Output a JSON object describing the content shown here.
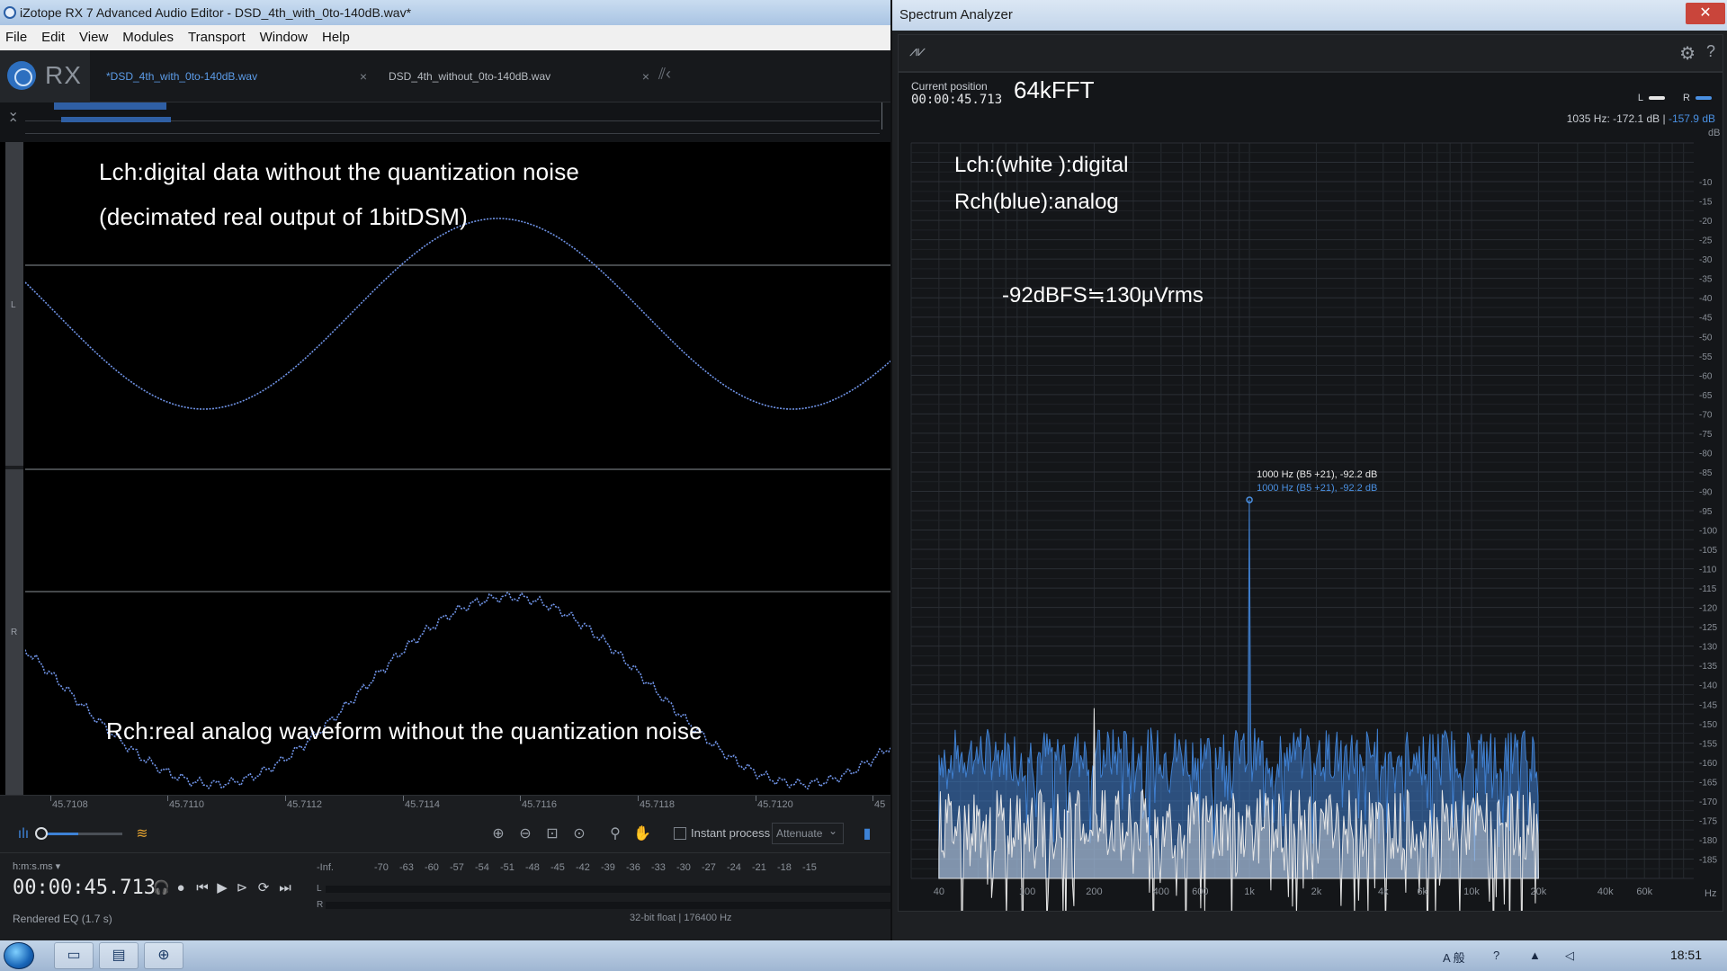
{
  "rx": {
    "title": "iZotope RX 7 Advanced Audio Editor - DSD_4th_with_0to-140dB.wav*",
    "menu": [
      "File",
      "Edit",
      "View",
      "Modules",
      "Transport",
      "Window",
      "Help"
    ],
    "logo": "RX",
    "tabs": [
      {
        "label": "*DSD_4th_with_0to-140dB.wav",
        "close": "×"
      },
      {
        "label": "DSD_4th_without_0to-140dB.wav",
        "close": "×"
      }
    ],
    "channel_l": "L",
    "channel_r": "R",
    "annotations": {
      "lch_line1": "Lch:digital data without the quantization noise",
      "lch_line2": "(decimated real output of 1bitDSM)",
      "rch": "Rch:real analog waveform without the quantization noise"
    },
    "time_ticks": [
      "45.7108",
      "45.7110",
      "45.7112",
      "45.7114",
      "45.7116",
      "45.7118",
      "45.7120",
      "45"
    ],
    "instant_process_label": "Instant process",
    "attenuate_value": "Attenuate",
    "time_format": "h:m:s.ms ▾",
    "current_time": "00:00:45.713",
    "status": "Rendered EQ (1.7 s)",
    "meter_labels": [
      "-Inf.",
      "-70",
      "-63",
      "-60",
      "-57",
      "-54",
      "-51",
      "-48",
      "-45",
      "-42",
      "-39",
      "-36",
      "-33",
      "-30",
      "-27",
      "-24",
      "-21",
      "-18",
      "-15"
    ],
    "meter_l": "L",
    "meter_r": "R",
    "format": "32-bit float | 176400 Hz",
    "zoom_level": 0.45
  },
  "analyzer": {
    "title": "Spectrum Analyzer",
    "close": "✕",
    "position_label": "Current position",
    "position_value": "00:00:45.713",
    "fft_label": "64kFFT",
    "legend_l": "L",
    "legend_r": "R",
    "readout_l": "1035 Hz: -172.1 dB",
    "readout_sep": " | ",
    "readout_r": "-157.9 dB",
    "db_unit": "dB",
    "hz_unit": "Hz",
    "annot_lch": "Lch:(white ):digital",
    "annot_rch": "Rch(blue):analog",
    "annot_level": "-92dBFS≒130μVrms",
    "peak_label_l": "1000 Hz (B5 +21), -92.2 dB",
    "peak_label_r": "1000 Hz (B5 +21), -92.2 dB"
  },
  "colors": {
    "waveform": "#6f93e6",
    "spectrum_r": "#3f7fcf",
    "spectrum_l": "#e6e6e6",
    "accent": "#4a90e2"
  },
  "chart_data": {
    "type": "area",
    "xscale": "log",
    "xlim": [
      30,
      100000
    ],
    "ylim": [
      -190,
      0
    ],
    "x_ticks": [
      {
        "v": 40,
        "label": "40"
      },
      {
        "v": 100,
        "label": "100"
      },
      {
        "v": 200,
        "label": "200"
      },
      {
        "v": 400,
        "label": "400"
      },
      {
        "v": 600,
        "label": "600"
      },
      {
        "v": 1000,
        "label": "1k"
      },
      {
        "v": 2000,
        "label": "2k"
      },
      {
        "v": 4000,
        "label": "4k"
      },
      {
        "v": 6000,
        "label": "6k"
      },
      {
        "v": 10000,
        "label": "10k"
      },
      {
        "v": 20000,
        "label": "20k"
      },
      {
        "v": 40000,
        "label": "40k"
      },
      {
        "v": 60000,
        "label": "60k"
      }
    ],
    "y_ticks": [
      -10,
      -15,
      -20,
      -25,
      -30,
      -35,
      -40,
      -45,
      -50,
      -55,
      -60,
      -65,
      -70,
      -75,
      -80,
      -85,
      -90,
      -95,
      -100,
      -105,
      -110,
      -115,
      -120,
      -125,
      -130,
      -135,
      -140,
      -145,
      -150,
      -155,
      -160,
      -165,
      -170,
      -175,
      -180,
      -185
    ],
    "series": [
      {
        "name": "R",
        "floor_db": -158,
        "upper_hz": 20000,
        "peak": {
          "hz": 1000,
          "db": -92.2
        }
      },
      {
        "name": "L",
        "floor_db": -176,
        "upper_hz": 20000,
        "spur": {
          "hz": 200,
          "db": -146
        }
      }
    ]
  },
  "taskbar": {
    "time": "18:51",
    "ime": "A 般"
  }
}
